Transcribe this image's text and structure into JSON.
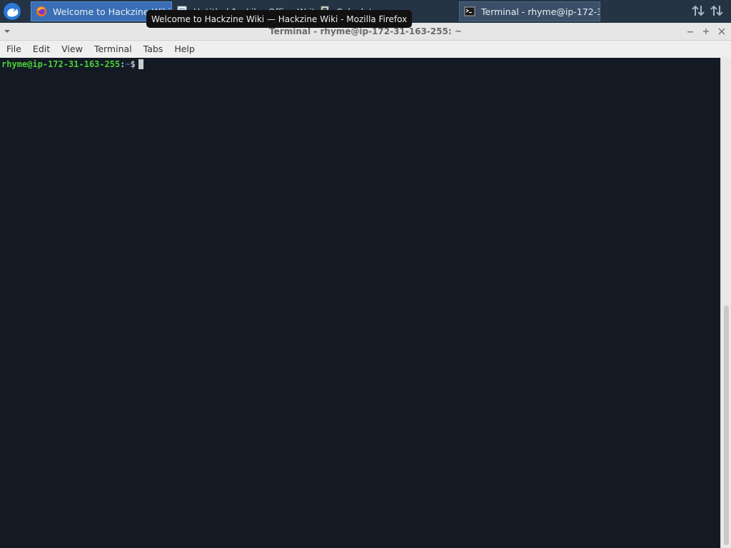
{
  "taskbar": {
    "tasks": [
      {
        "label": "Welcome to Hackzine Wiki",
        "app": "firefox",
        "state": "active"
      },
      {
        "label": "Untitled 1 - LibreOffice Writer",
        "app": "writer",
        "state": "inactive"
      },
      {
        "label": "Calculator",
        "app": "calculator",
        "state": "inactive"
      },
      {
        "label": "Terminal - rhyme@ip-172-31...",
        "app": "terminal",
        "state": "open"
      }
    ],
    "tray_icons": [
      "network-transfer-icon",
      "network-transfer-icon"
    ]
  },
  "tooltip": {
    "text": "Welcome to Hackzine Wiki — Hackzine Wiki - Mozilla Firefox"
  },
  "window": {
    "title": "Terminal - rhyme@ip-172-31-163-255: ~",
    "buttons": [
      "minimize",
      "maximize",
      "close"
    ]
  },
  "menubar": {
    "items": [
      "File",
      "Edit",
      "View",
      "Terminal",
      "Tabs",
      "Help"
    ]
  },
  "terminal": {
    "prompt_user": "rhyme@ip-172-31-163-255",
    "prompt_colon": ":",
    "prompt_path": "~",
    "prompt_symbol": "$",
    "colors": {
      "background": "#131a24",
      "user": "#4ccf3a",
      "path": "#2f6fb0"
    }
  }
}
